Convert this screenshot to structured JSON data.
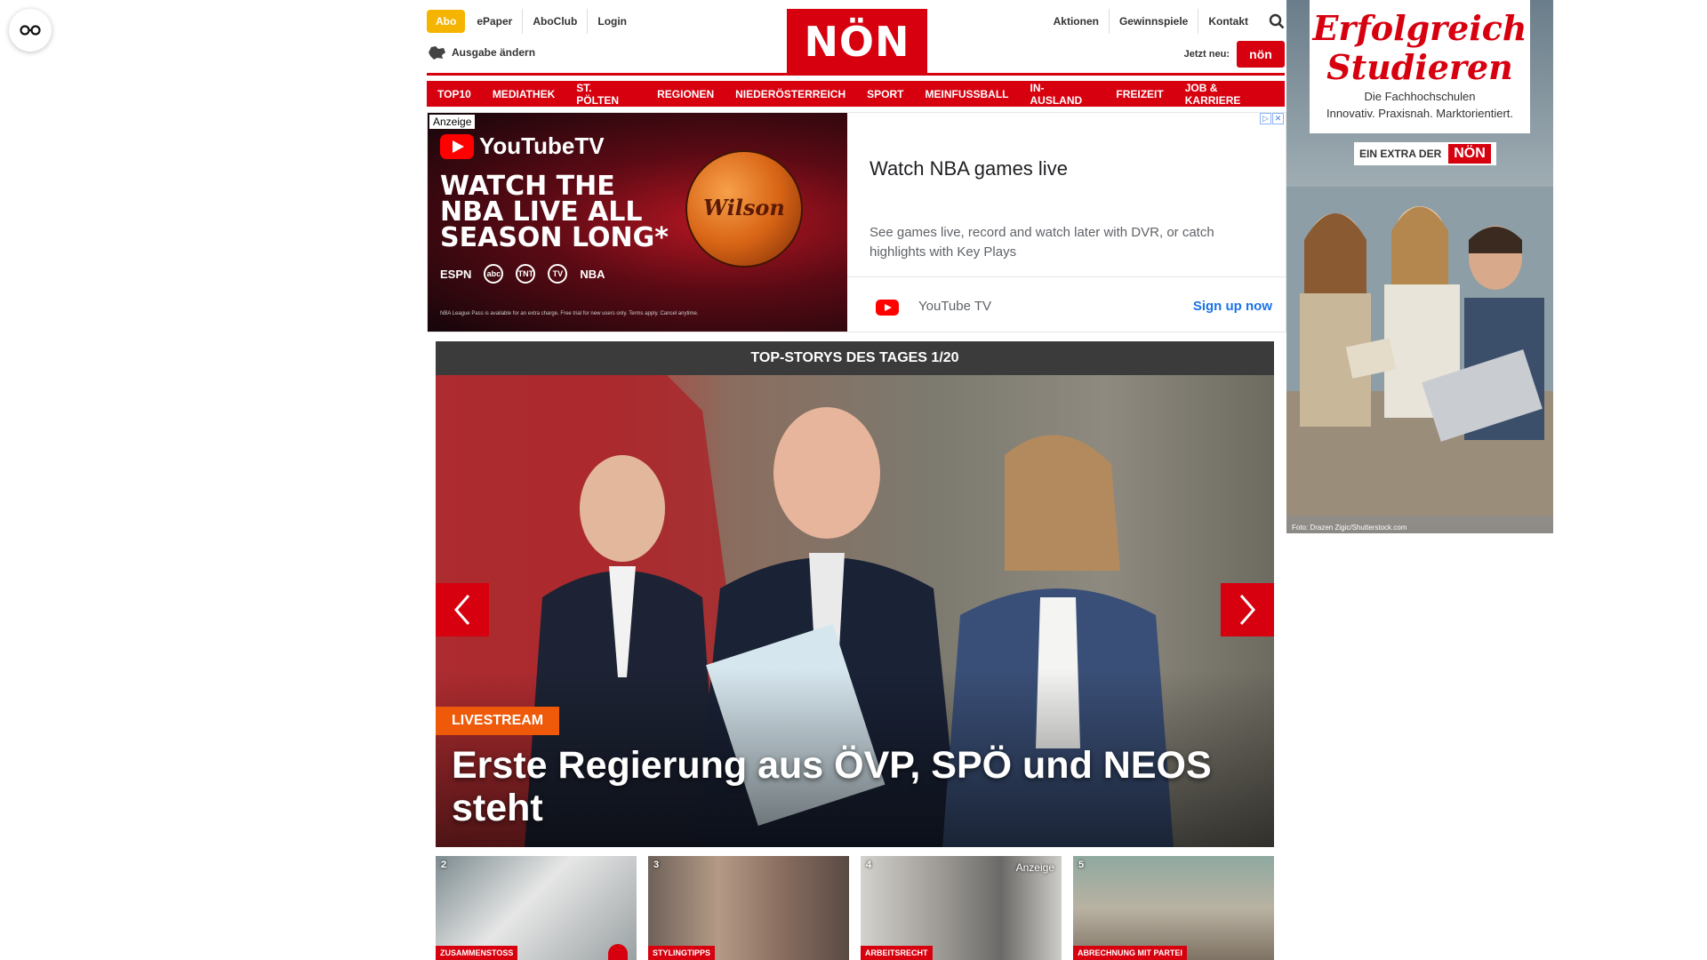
{
  "header": {
    "abo": "Abo",
    "links_left": [
      "ePaper",
      "AboClub",
      "Login"
    ],
    "edition": "Ausgabe ändern",
    "logo": "NÖN",
    "links_right": [
      "Aktionen",
      "Gewinnspiele",
      "Kontakt"
    ],
    "jetzt_neu": "Jetzt neu:",
    "jetzt_badge": "nön"
  },
  "nav": [
    "TOP10",
    "MEDIATHEK",
    "ST. PÖLTEN",
    "REGIONEN",
    "NIEDERÖSTERREICH",
    "SPORT",
    "MEINFUSSBALL",
    "IN-AUSLAND",
    "FREIZEIT",
    "JOB & KARRIERE"
  ],
  "ad": {
    "label": "Anzeige",
    "brand": "YouTubeTV",
    "headline": "WATCH THE NBA LIVE ALL SEASON LONG*",
    "networks": [
      "ESPN",
      "abc",
      "TNT",
      "TV",
      "NBA"
    ],
    "ball_brand": "Wilson",
    "fine_print": "NBA League Pass is available for an extra charge. Free trial for new users only. Terms apply. Cancel anytime.",
    "title": "Watch NBA games live",
    "description": "See games live, record and watch later with DVR, or catch highlights with Key Plays",
    "advertiser": "YouTube TV",
    "cta": "Sign up now"
  },
  "side_ad": {
    "title": "Erfolgreich Studieren",
    "subtitle_1": "Die Fachhochschulen",
    "subtitle_2": "Innovativ. Praxisnah. Marktorientiert.",
    "extra": "EIN EXTRA DER",
    "extra_badge": "NÖN",
    "credit": "Foto: Drazen Zigic/Shutterstock.com"
  },
  "stories": {
    "bar_title": "TOP-STORYS DES TAGES 1/20",
    "tag": "LIVESTREAM",
    "headline": "Erste Regierung aus ÖVP, SPÖ und NEOS steht"
  },
  "thumbs": [
    {
      "num": "2",
      "category": "ZUSAMMENSTOSS"
    },
    {
      "num": "3",
      "category": "STYLINGTIPPS"
    },
    {
      "num": "4",
      "category": "ARBEITSRECHT",
      "sponsored": "Anzeige"
    },
    {
      "num": "5",
      "category": "ABRECHNUNG MIT PARTEI"
    }
  ],
  "colors": {
    "brand_red": "#d7000f",
    "abo_yellow": "#f4b400",
    "live_orange": "#ee5a0a"
  }
}
